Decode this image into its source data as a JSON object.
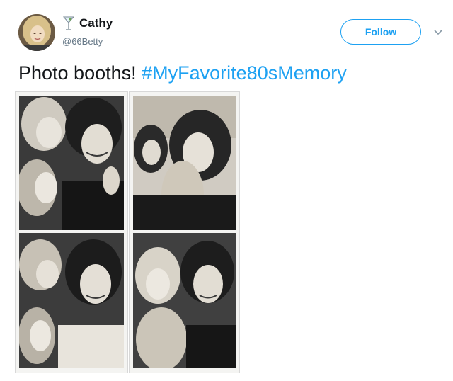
{
  "user": {
    "display_name": "Cathy",
    "handle": "@66Betty",
    "name_emoji": "cocktail-glass-icon"
  },
  "actions": {
    "follow_label": "Follow",
    "more_icon": "chevron-down-icon"
  },
  "tweet": {
    "text": "Photo booths! ",
    "hashtag": "#MyFavorite80sMemory"
  },
  "colors": {
    "accent": "#1da1f2",
    "text": "#14171a",
    "muted": "#657786"
  }
}
